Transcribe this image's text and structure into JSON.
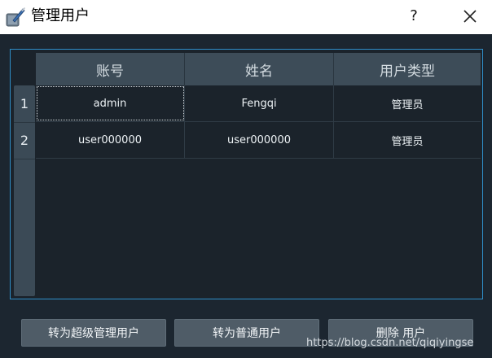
{
  "window": {
    "title": "管理用户",
    "help_label": "?",
    "icons": {
      "app": "quill-app-icon",
      "close": "close-icon"
    }
  },
  "table": {
    "columns": [
      "账号",
      "姓名",
      "用户类型"
    ],
    "row_numbers": [
      "1",
      "2"
    ],
    "rows": [
      [
        "admin",
        "Fengqi",
        "管理员"
      ],
      [
        "user000000",
        "user000000",
        "管理员"
      ]
    ]
  },
  "buttons": {
    "make_super_admin": "转为超级管理用户",
    "make_normal": "转为普通用户",
    "delete_user": "删除 用户"
  },
  "watermark": "https://blog.csdn.net/qiqiyingse",
  "colors": {
    "background": "#1c2630",
    "header": "#3d4c58",
    "accent_border": "#2f8fc9",
    "button": "#4f5c67"
  }
}
